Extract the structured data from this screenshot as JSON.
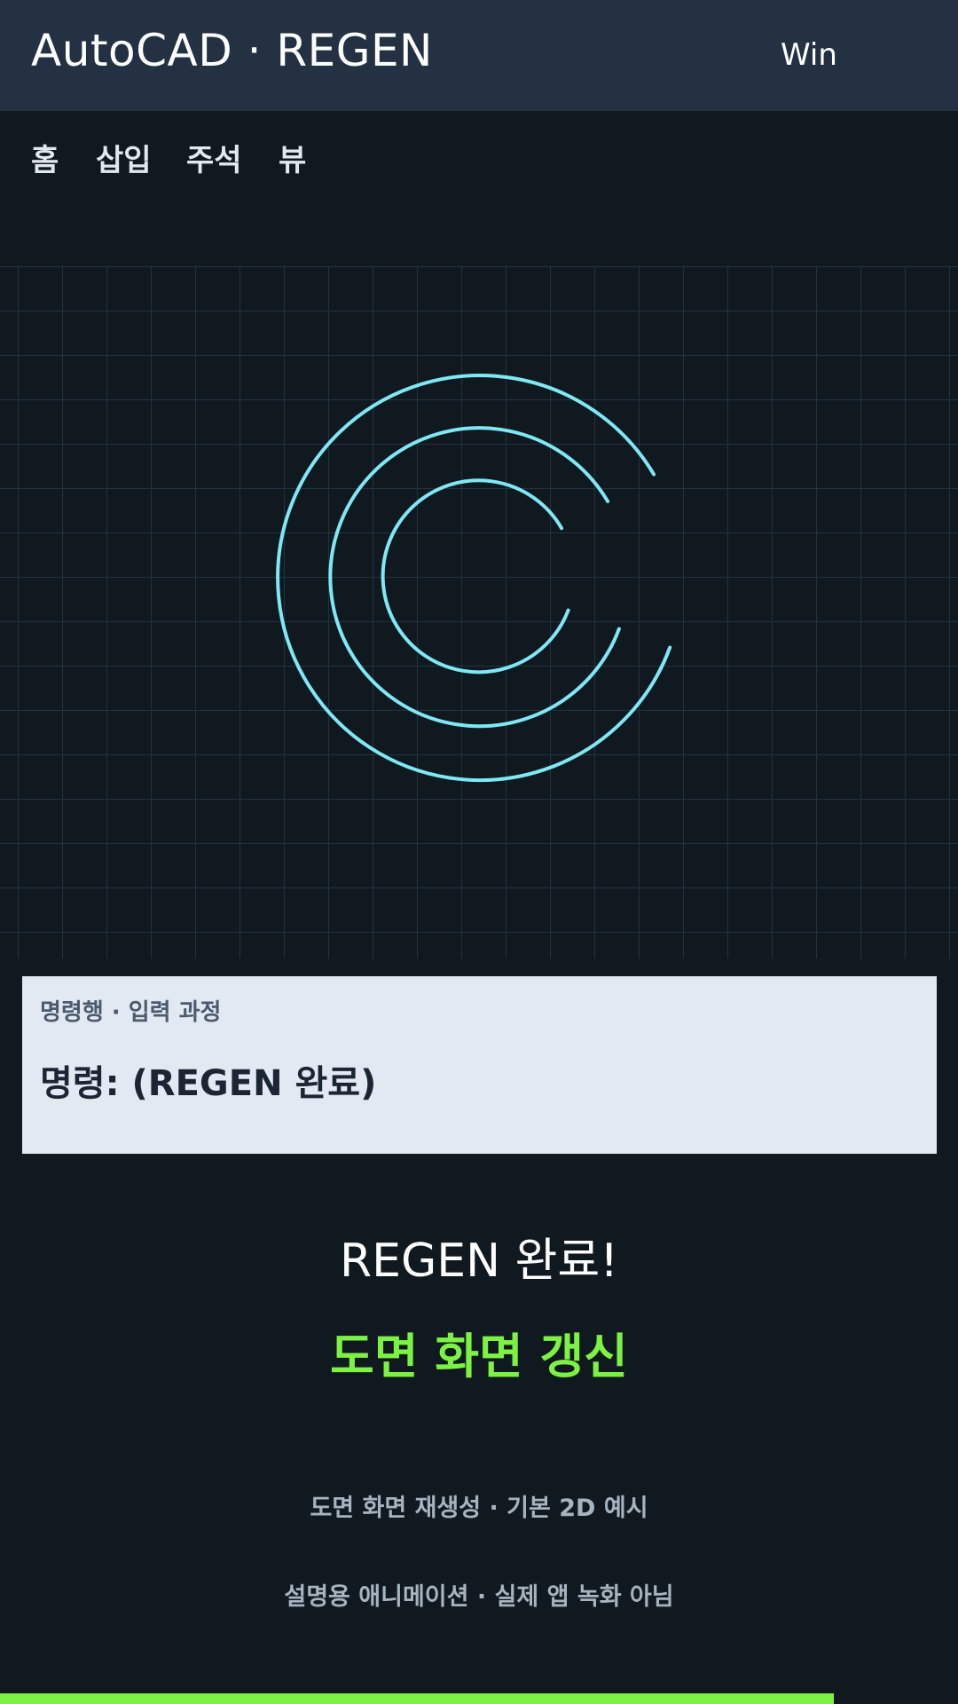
{
  "header": {
    "title": "AutoCAD · REGEN",
    "platform": "Win"
  },
  "ribbon": {
    "tabs": [
      {
        "label": "홈"
      },
      {
        "label": "삽입"
      },
      {
        "label": "주석"
      },
      {
        "label": "뷰"
      }
    ]
  },
  "drawing": {
    "shape": "concentric-arcs",
    "accent_color": "#7ee8f5",
    "arc_count": 3
  },
  "command_line": {
    "caption": "명령행 · 입력 과정",
    "text": "명령: (REGEN 완료)"
  },
  "status": {
    "title": "REGEN 완료!",
    "subtitle": "도면 화면 갱신",
    "accent_color": "#7cf242"
  },
  "notes": [
    "도면 화면 재생성 · 기본 2D 예시",
    "설명용 애니메이션 · 실제 앱 녹화 아님"
  ],
  "progress": {
    "value": 0.87
  },
  "colors": {
    "background": "#111920",
    "titlebar": "#233142",
    "command_panel": "#e3e9f2"
  }
}
